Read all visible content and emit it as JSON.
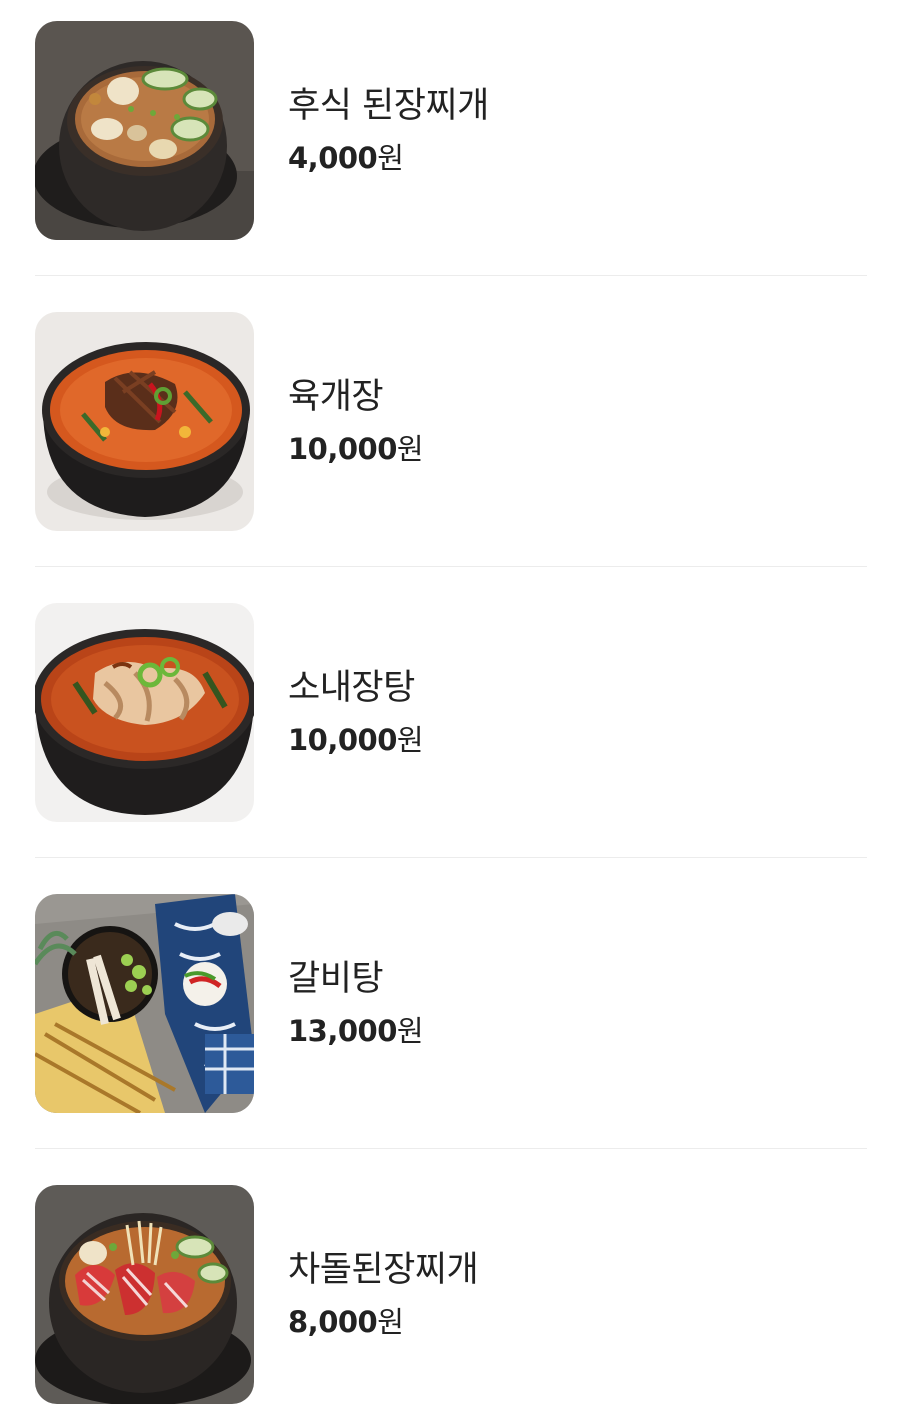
{
  "menu": {
    "currency_unit": "원",
    "items": [
      {
        "name": "후식 된장찌개",
        "price": "4,000",
        "image_icon": "doenjang-stew-photo"
      },
      {
        "name": "육개장",
        "price": "10,000",
        "image_icon": "yukgaejang-photo"
      },
      {
        "name": "소내장탕",
        "price": "10,000",
        "image_icon": "beef-tripe-soup-photo"
      },
      {
        "name": "갈비탕",
        "price": "13,000",
        "image_icon": "galbitang-photo"
      },
      {
        "name": "차돌된장찌개",
        "price": "8,000",
        "image_icon": "chadol-doenjang-stew-photo"
      }
    ]
  }
}
